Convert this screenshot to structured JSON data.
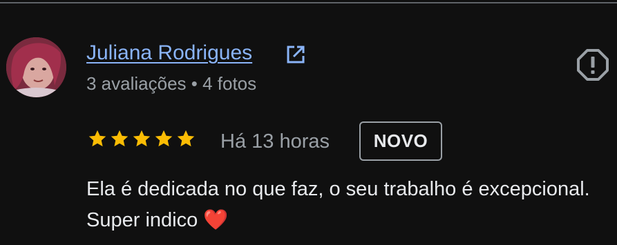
{
  "reviewer": {
    "name": "Juliana Rodrigues",
    "meta": "3 avaliações • 4 fotos"
  },
  "review": {
    "rating": 5,
    "rating_max": 5,
    "time": "Há 13 horas",
    "badge": "NOVO",
    "text": "Ela é dedicada no que faz, o seu trabalho é excepcional. Super indico ❤️"
  },
  "colors": {
    "background": "#101010",
    "link": "#8ab4f8",
    "star": "#fbbc04",
    "secondary_text": "#9aa0a6",
    "primary_text": "#e8eaed"
  },
  "icons": {
    "external_link": "external-link-icon",
    "report": "report-icon",
    "star": "star-icon"
  }
}
